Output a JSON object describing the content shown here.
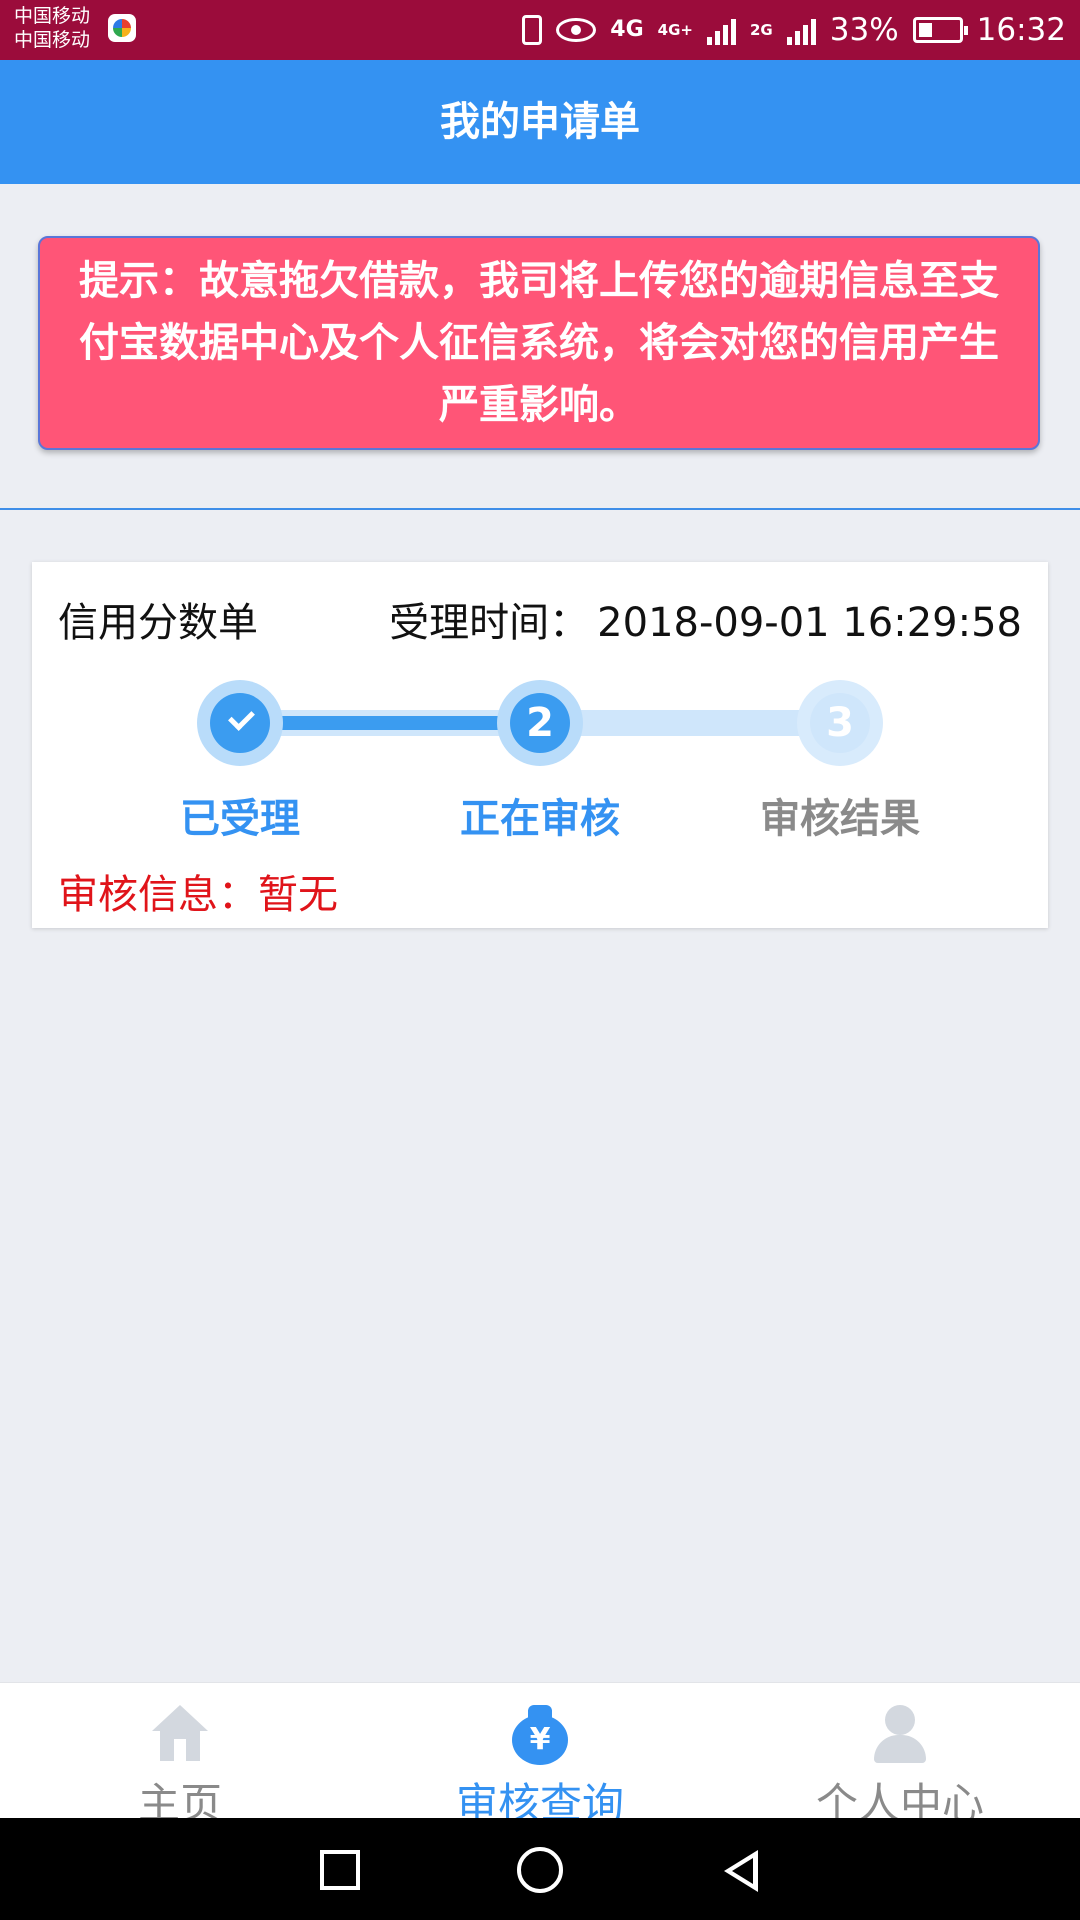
{
  "status_bar": {
    "carrier_1": "中国移动",
    "carrier_2": "中国移动",
    "network_1": "4G",
    "network_1b": "4G+",
    "network_2": "2G",
    "battery": "33%",
    "battery_level": 0.33,
    "time": "16:32"
  },
  "header": {
    "title": "我的申请单"
  },
  "notice": {
    "text": "提示：故意拖欠借款，我司将上传您的逾期信息至支付宝数据中心及个人征信系统，将会对您的信用产生严重影响。"
  },
  "application": {
    "title": "信用分数单",
    "time_label": "受理时间：",
    "time_value": "2018-09-01 16:29:58",
    "steps": [
      {
        "number": "",
        "label": "已受理",
        "state": "done"
      },
      {
        "number": "2",
        "label": "正在审核",
        "state": "active"
      },
      {
        "number": "3",
        "label": "审核结果",
        "state": "pending"
      }
    ],
    "audit_info": "审核信息：暂无"
  },
  "bottom_nav": {
    "items": [
      {
        "label": "主页",
        "icon": "home-icon",
        "active": false
      },
      {
        "label": "审核查询",
        "icon": "money-bag-icon",
        "active": true
      },
      {
        "label": "个人中心",
        "icon": "user-icon",
        "active": false
      }
    ]
  },
  "colors": {
    "status_bar": "#9b0c3b",
    "primary": "#3492f2",
    "notice_bg": "#ff5577",
    "danger_text": "#e0141a",
    "inactive": "#8a8a8a"
  }
}
